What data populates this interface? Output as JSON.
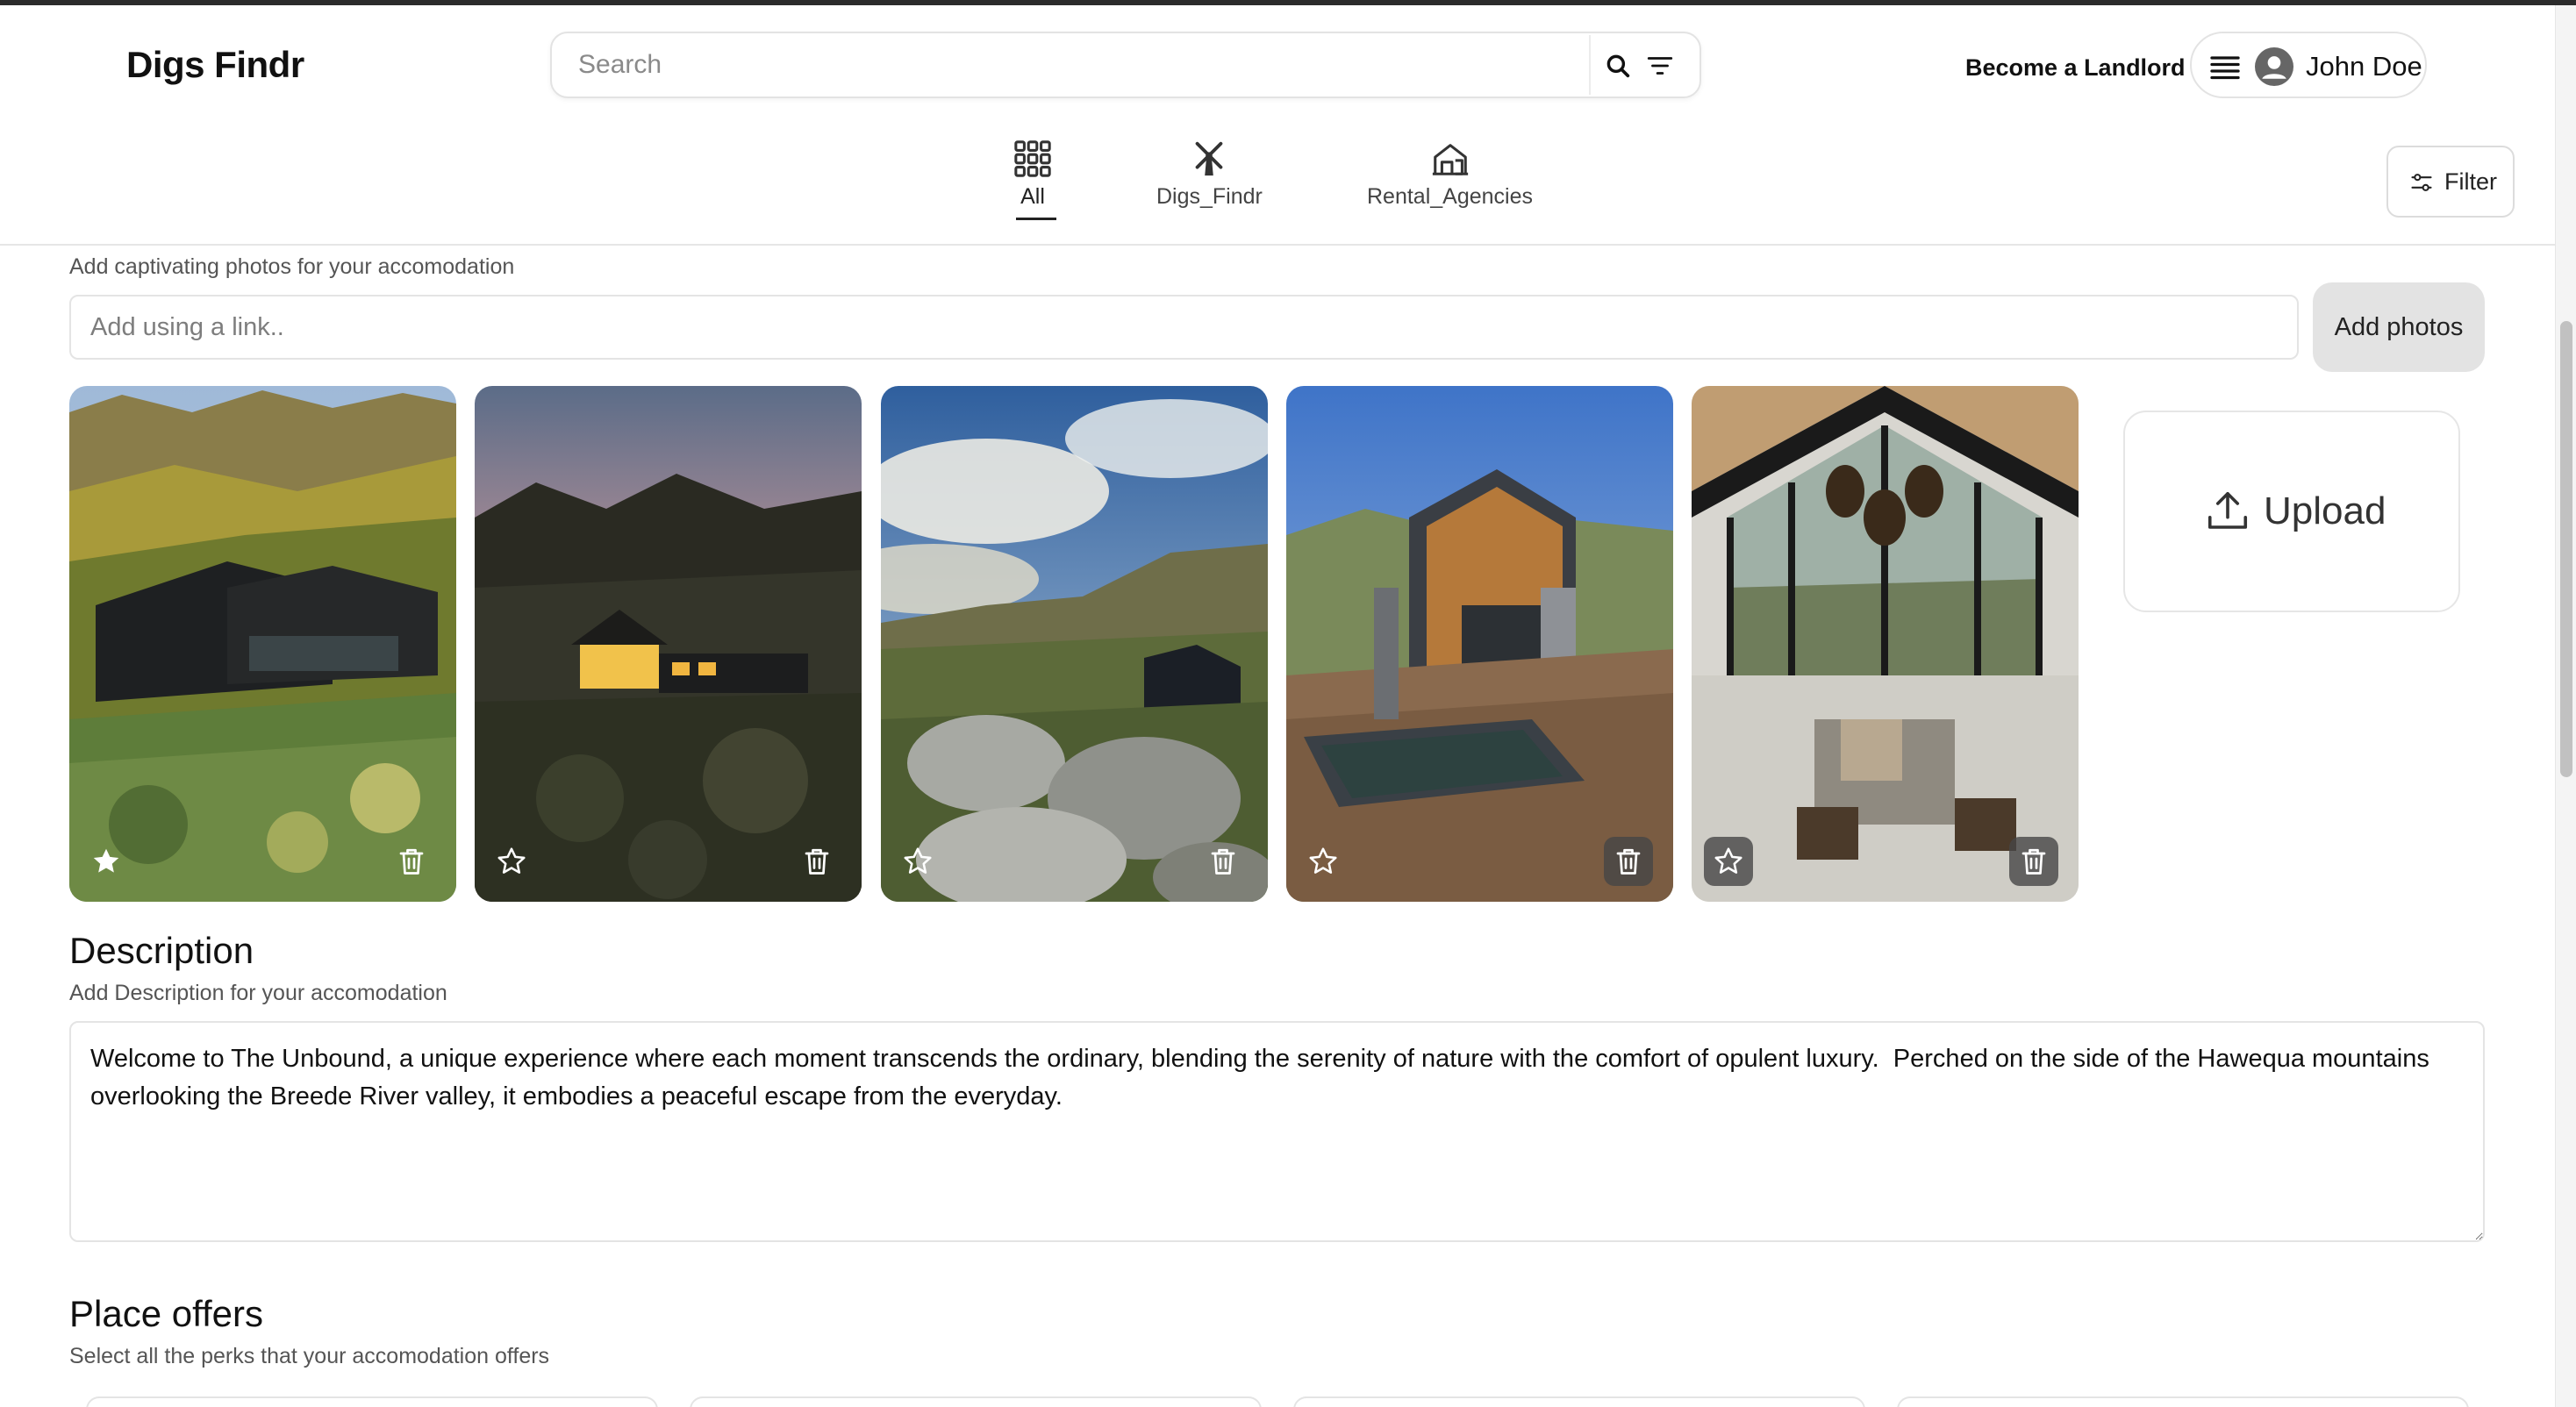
{
  "app": {
    "logo": "Digs Findr"
  },
  "header": {
    "search_placeholder": "Search",
    "become_landlord": "Become a Landlord",
    "user_name": "John Doe",
    "categories": [
      {
        "label": "All",
        "icon": "grid-icon",
        "active": true
      },
      {
        "label": "Digs_Findr",
        "icon": "windmill-icon",
        "active": false
      },
      {
        "label": "Rental_Agencies",
        "icon": "house-icon",
        "active": false
      }
    ],
    "filter_label": "Filter"
  },
  "photos": {
    "hint": "Add captivating photos for your accomodation",
    "link_placeholder": "Add using a link..",
    "add_button": "Add photos",
    "upload_label": "Upload",
    "items": [
      {
        "subject": "black cabin on green mountain slope",
        "featured": true
      },
      {
        "subject": "lit cabin at dusk under pink sky",
        "featured": false
      },
      {
        "subject": "cloudy valley with rocks and small cabin",
        "featured": false
      },
      {
        "subject": "modern house with deck and plunge pool",
        "featured": false
      },
      {
        "subject": "interior living room with A-frame glass wall",
        "featured": false
      }
    ]
  },
  "description": {
    "title": "Description",
    "hint": "Add Description for your accomodation",
    "value": "Welcome to The Unbound, a unique experience where each moment transcends the ordinary, blending the serenity of nature with the comfort of opulent luxury.  Perched on the side of the Hawequa mountains overlooking the Breede River valley, it embodies a peaceful escape from the everyday."
  },
  "offers": {
    "title": "Place offers",
    "hint": "Select all the perks that your accomodation offers"
  },
  "colors": {
    "accent": "#111111",
    "border": "#e4e4e4",
    "button_grey": "#e3e3e3"
  }
}
